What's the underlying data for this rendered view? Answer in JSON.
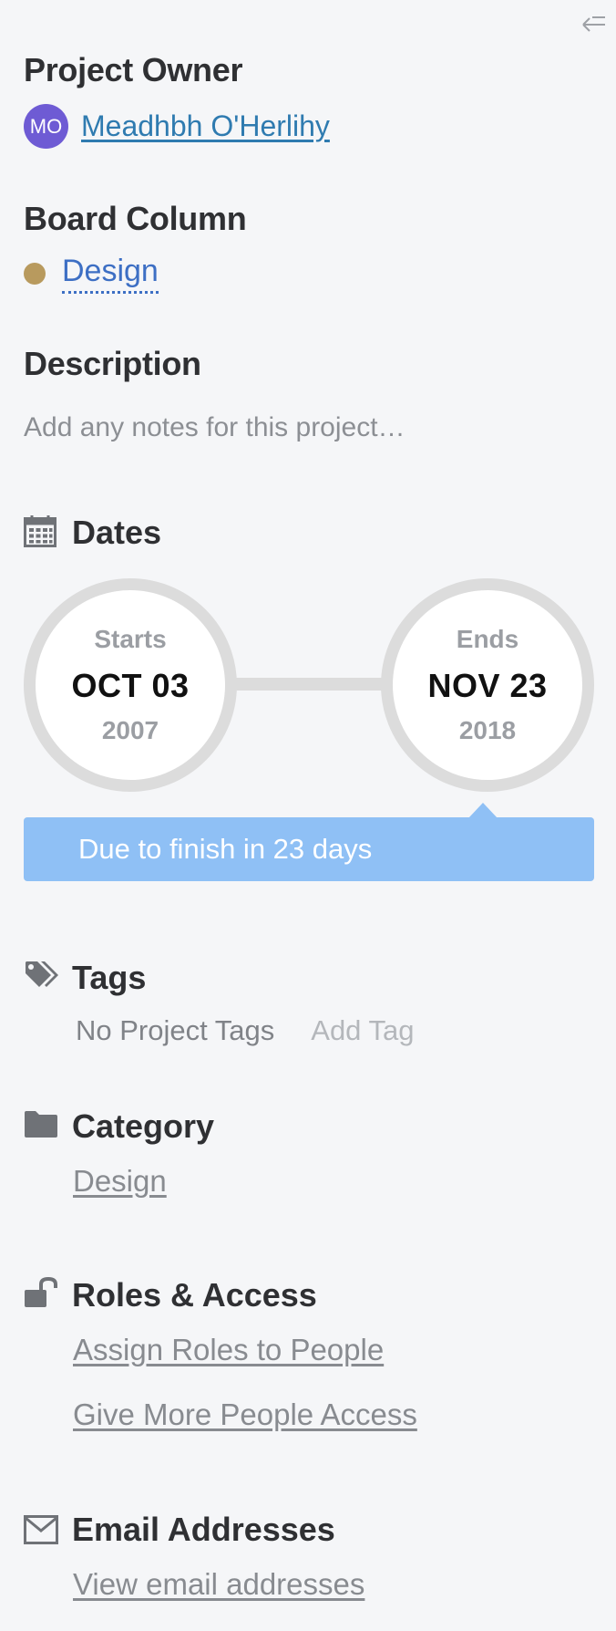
{
  "owner": {
    "heading": "Project Owner",
    "initials": "MO",
    "name": "Meadhbh O'Herlihy"
  },
  "board_column": {
    "heading": "Board Column",
    "value": "Design",
    "dot_color": "#b89a5e"
  },
  "description": {
    "heading": "Description",
    "placeholder": "Add any notes for this project…"
  },
  "dates": {
    "heading": "Dates",
    "icon": "calendar-icon",
    "start": {
      "label": "Starts",
      "date": "OCT 03",
      "year": "2007"
    },
    "end": {
      "label": "Ends",
      "date": "NOV 23",
      "year": "2018"
    },
    "due_message": "Due to finish in 23 days",
    "banner_color": "#8fc0f5"
  },
  "tags": {
    "heading": "Tags",
    "icon": "tags-icon",
    "empty_text": "No Project Tags",
    "add_label": "Add Tag"
  },
  "category": {
    "heading": "Category",
    "icon": "folder-icon",
    "value": "Design"
  },
  "roles": {
    "heading": "Roles & Access",
    "icon": "unlock-icon",
    "assign_link": "Assign Roles to People",
    "access_link": "Give More People Access"
  },
  "email": {
    "heading": "Email Addresses",
    "icon": "envelope-icon",
    "view_link": "View email addresses"
  },
  "colors": {
    "avatar": "#6e5bd4",
    "owner_link": "#2f7bb0",
    "column_link": "#3d6fc4"
  }
}
